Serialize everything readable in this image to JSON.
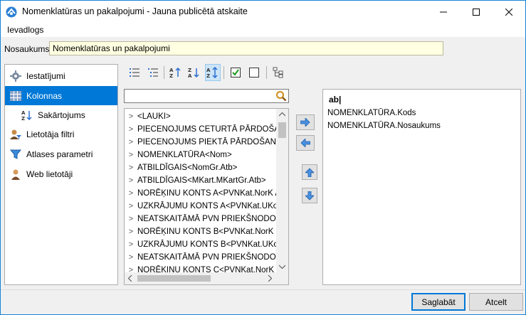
{
  "window": {
    "title": "Nomenklatūras un pakalpojumi - Jauna publicētā atskaite"
  },
  "menu": {
    "item": "Ievadlogs"
  },
  "name_field": {
    "label": "Nosaukums:",
    "value": "Nomenklatūras un pakalpojumi"
  },
  "nav": {
    "items": [
      {
        "label": "Iestatījumi",
        "icon": "gear-icon"
      },
      {
        "label": "Kolonnas",
        "icon": "columns-icon",
        "selected": true
      },
      {
        "label": "Sakārtojums",
        "icon": "sort-az-icon",
        "indented": true
      },
      {
        "label": "Lietotāja filtri",
        "icon": "user-filter-icon"
      },
      {
        "label": "Atlases parametri",
        "icon": "funnel-icon"
      },
      {
        "label": "Web lietotāji",
        "icon": "user-icon"
      }
    ]
  },
  "search": {
    "value": "",
    "placeholder": ""
  },
  "fields": [
    "<LAUKI>",
    "PIECENOJUMS CETURTĀ PĀRDOŠANAS",
    "PIECENOJUMS PIEKTĀ PĀRDOŠANAS CE",
    "NOMENKLATŪRA<Nom>",
    "ATBILDĪGAIS<NomGr.Atb>",
    "ATBILDĪGAIS<MKart.MKartGr.Atb>",
    "NORĒĶINU KONTS A<PVNKat.NorK A>",
    "UZKRĀJUMU KONTS A<PVNKat.UKon A>",
    "NEATSKAITĀMĀ PVN PRIEKŠNODOKĻA K",
    "NORĒĶINU KONTS B<PVNKat.NorK B>",
    "UZKRĀJUMU KONTS B<PVNKat.UKon B>",
    "NEATSKAITĀMĀ PVN PRIEKŠNODOKĻA K",
    "NORĒĶINU KONTS C<PVNKat.NorK C>"
  ],
  "selected_columns": {
    "header": "ab|",
    "items": [
      "NOMENKLATŪRA.Kods",
      "NOMENKLATŪRA.Nosaukums"
    ]
  },
  "buttons": {
    "save": "Saglabāt",
    "cancel": "Atcelt"
  },
  "colors": {
    "accent": "#0078d7",
    "input_bg": "#ffffe1"
  }
}
